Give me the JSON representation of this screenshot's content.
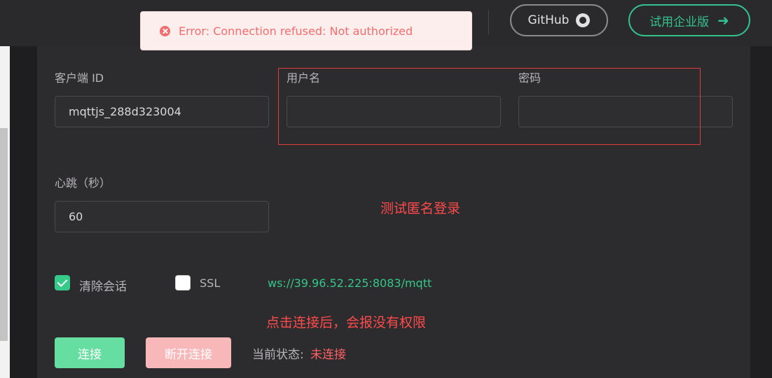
{
  "header": {
    "github_label": "GitHub",
    "trial_label": "试用企业版",
    "github_icon": "github-icon",
    "arrow_icon": "arrow-right-icon"
  },
  "toast": {
    "message": "Error: Connection refused: Not authorized",
    "icon": "error-circle-icon"
  },
  "form": {
    "client_id_label": "客户端 ID",
    "client_id_value": "mqttjs_288d323004",
    "username_label": "用户名",
    "username_value": "",
    "password_label": "密码",
    "password_value": "",
    "keepalive_label": "心跳（秒）",
    "keepalive_value": "60",
    "clean_session_label": "清除会话",
    "clean_session_checked": true,
    "ssl_label": "SSL",
    "ssl_checked": false,
    "url": "ws://39.96.52.225:8083/mqtt"
  },
  "annotations": {
    "anonymous_test": "测试匿名登录",
    "connect_note": "点击连接后，会报没有权限"
  },
  "actions": {
    "connect_label": "连接",
    "disconnect_label": "断开连接",
    "status_label": "当前状态:",
    "status_value": "未连接"
  },
  "colors": {
    "accent": "#33c28d",
    "error": "#f56c6c",
    "annotation": "#e23c3c"
  }
}
